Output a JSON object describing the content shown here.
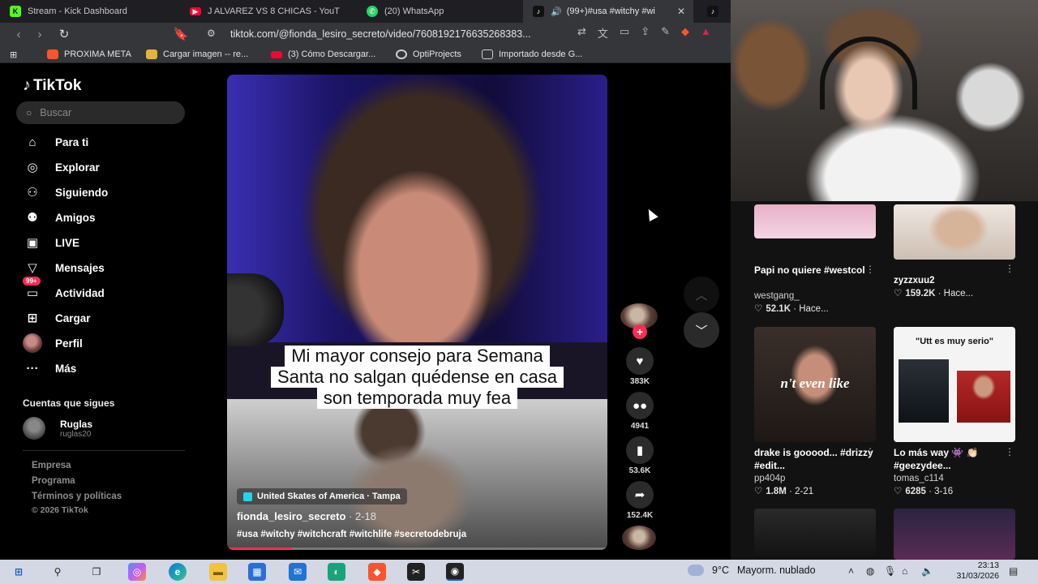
{
  "browser": {
    "tabs": [
      {
        "title": "Stream - Kick Dashboard",
        "icon": "kick-icon",
        "color": "#53fc18"
      },
      {
        "title": "J ALVAREZ VS 8 CHICAS - YouT",
        "icon": "youtube-icon",
        "color": "#ff0033"
      },
      {
        "title": "(20) WhatsApp",
        "icon": "whatsapp-icon",
        "color": "#25d366"
      },
      {
        "title": "(99+)#usa #witchy #wi",
        "icon": "tiktok-icon",
        "color": "#ffffff"
      }
    ],
    "url": "tiktok.com/@fionda_lesiro_secreto/video/7608192176635268383...",
    "bookmarks": [
      {
        "label": "PROXIMA META",
        "icon": "brave-icon",
        "color": "#fb542b"
      },
      {
        "label": "Cargar imagen -- re...",
        "icon": "folder-image-icon",
        "color": "#e5b23a"
      },
      {
        "label": "(3) Cómo Descargar...",
        "icon": "youtube-icon",
        "color": "#ff0033"
      },
      {
        "label": "OptiProjects",
        "icon": "opti-icon",
        "color": "#cfcfcf"
      },
      {
        "label": "Importado desde G...",
        "icon": "folder-icon",
        "color": "#cfcfcf"
      }
    ]
  },
  "tiktok": {
    "logo": "TikTok",
    "search_placeholder": "Buscar",
    "nav": [
      {
        "label": "Para ti",
        "icon": "home-icon"
      },
      {
        "label": "Explorar",
        "icon": "compass-icon"
      },
      {
        "label": "Siguiendo",
        "icon": "following-icon"
      },
      {
        "label": "Amigos",
        "icon": "friends-icon"
      },
      {
        "label": "LIVE",
        "icon": "live-icon"
      },
      {
        "label": "Mensajes",
        "icon": "send-icon"
      },
      {
        "label": "Actividad",
        "icon": "activity-icon",
        "badge": "99+"
      },
      {
        "label": "Cargar",
        "icon": "upload-icon"
      },
      {
        "label": "Perfil",
        "icon": "profile-avatar"
      },
      {
        "label": "Más",
        "icon": "more-icon"
      }
    ],
    "following_header": "Cuentas que sigues",
    "following": [
      {
        "name": "Ruglas",
        "handle": "ruglas20"
      }
    ],
    "footer": [
      "Empresa",
      "Programa",
      "Términos y políticas",
      "© 2026 TikTok"
    ]
  },
  "video": {
    "caption_lines": [
      "Mi mayor consejo para Semana",
      "Santa no salgan quédense en casa",
      "son temporada muy fea"
    ],
    "location": "United Skates of America · Tampa",
    "author": "fionda_lesiro_secreto",
    "date": "· 2-18",
    "tags": "#usa #witchy #witchcraft #witchlife #secretodebruja",
    "progress_percent": 17,
    "actions": {
      "likes": "383K",
      "comments": "4941",
      "saves": "53.6K",
      "shares": "152.4K"
    }
  },
  "grid": [
    {
      "title": "Papi no quiere #westcol",
      "author": "westgang_",
      "stat": "52.1K",
      "age": "· Hace..."
    },
    {
      "title": "zyzzxuu2",
      "author": "",
      "stat": "159.2K",
      "age": "· Hace..."
    },
    {
      "title": "drake is gooood... #drizzy #edit...",
      "author": "pp404p",
      "stat": "1.8M",
      "age": "· 2-21",
      "overlay": "n't even like"
    },
    {
      "title": "Lo más way 👾 👏🏻 #geezydee...",
      "author": "tomas_c114",
      "stat": "6285",
      "age": "· 3-16",
      "overlay": "\"Utt es muy serio\""
    }
  ],
  "taskbar": {
    "weather_temp": "9°C",
    "weather_text": "Mayorm. nublado",
    "time": "23:13",
    "date": "31/03/2026"
  }
}
